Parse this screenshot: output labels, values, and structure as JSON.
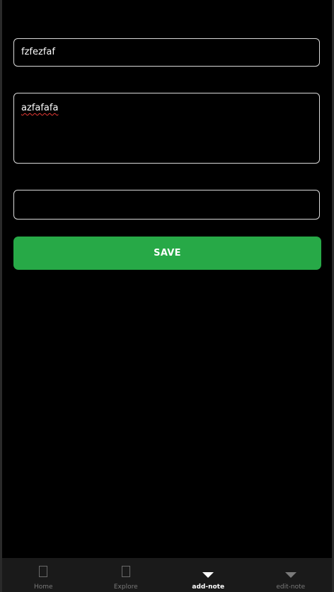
{
  "form": {
    "title_value": "fzfezfaf",
    "body_value": "azfafafa",
    "extra_value": "",
    "save_label": "SAVE"
  },
  "tabs": [
    {
      "label": "Home",
      "icon": "square-icon",
      "active": false
    },
    {
      "label": "Explore",
      "icon": "square-icon",
      "active": false
    },
    {
      "label": "add-note",
      "icon": "triangle-down-icon",
      "active": true
    },
    {
      "label": "edit-note",
      "icon": "triangle-down-icon",
      "active": false
    }
  ],
  "colors": {
    "background": "#000000",
    "accent": "#27a947",
    "tabbar": "#1a1a1a",
    "active_tab": "#ffffff",
    "inactive_tab": "#7a7a7a"
  }
}
